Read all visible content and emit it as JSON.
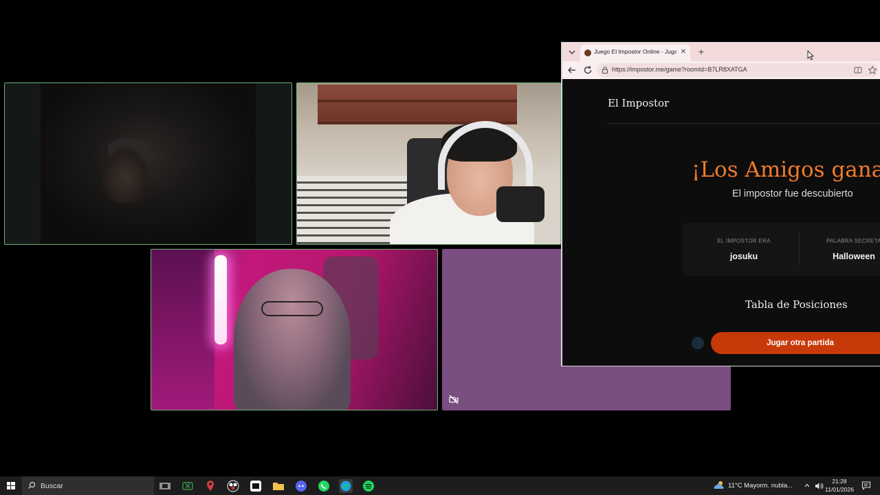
{
  "browser": {
    "tab_title": "Juego El Impostor Online - Jugar g",
    "url": "https://impostor.me/game?roomId=B7LR8XATGA"
  },
  "page": {
    "site_title": "El Impostor",
    "result_heading": "¡Los Amigos gana",
    "result_subtitle": "El impostor fue descubierto",
    "impostor_label": "EL IMPOSTOR ERA",
    "impostor_name": "josuku",
    "secret_word_label": "PALABRA SECRETA",
    "secret_word": "Halloween",
    "leaderboard_heading": "Tabla de Posiciones",
    "play_again_label": "Jugar otra partida"
  },
  "taskbar": {
    "search_label": "Buscar",
    "weather": "11°C  Mayorm. nubla...",
    "time": "21:28",
    "date": "11/01/2026"
  },
  "colors": {
    "accent_orange": "#f07a2b",
    "play_button": "#c8390a",
    "purple_tile": "#7a4e80",
    "active_border": "#6fb37a"
  }
}
